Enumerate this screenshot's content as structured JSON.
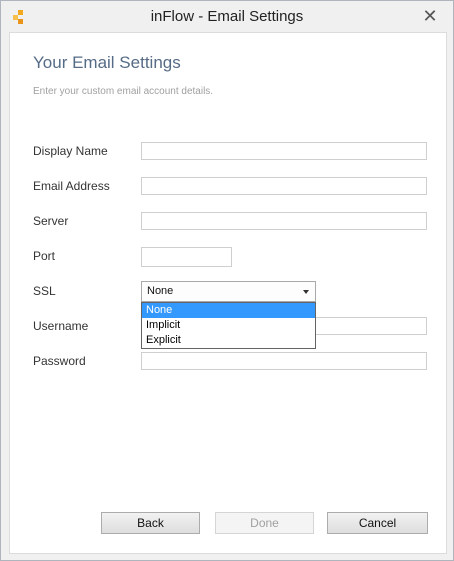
{
  "window": {
    "title": "inFlow - Email Settings",
    "close_glyph": "✕",
    "icon": "inflow-app-icon"
  },
  "header": {
    "title": "Your Email Settings",
    "subtitle": "Enter your custom email account details."
  },
  "form": {
    "display_name": {
      "label": "Display Name",
      "value": ""
    },
    "email_address": {
      "label": "Email Address",
      "value": ""
    },
    "server": {
      "label": "Server",
      "value": ""
    },
    "port": {
      "label": "Port",
      "value": ""
    },
    "ssl": {
      "label": "SSL",
      "value": "None",
      "options": [
        "None",
        "Implicit",
        "Explicit"
      ]
    },
    "username": {
      "label": "Username",
      "value": ""
    },
    "password": {
      "label": "Password",
      "value": ""
    }
  },
  "buttons": {
    "back": "Back",
    "done": "Done",
    "cancel": "Cancel"
  },
  "colors": {
    "accent": "#3399ff",
    "heading": "#566b86",
    "app_icon": "#f2a81d"
  }
}
